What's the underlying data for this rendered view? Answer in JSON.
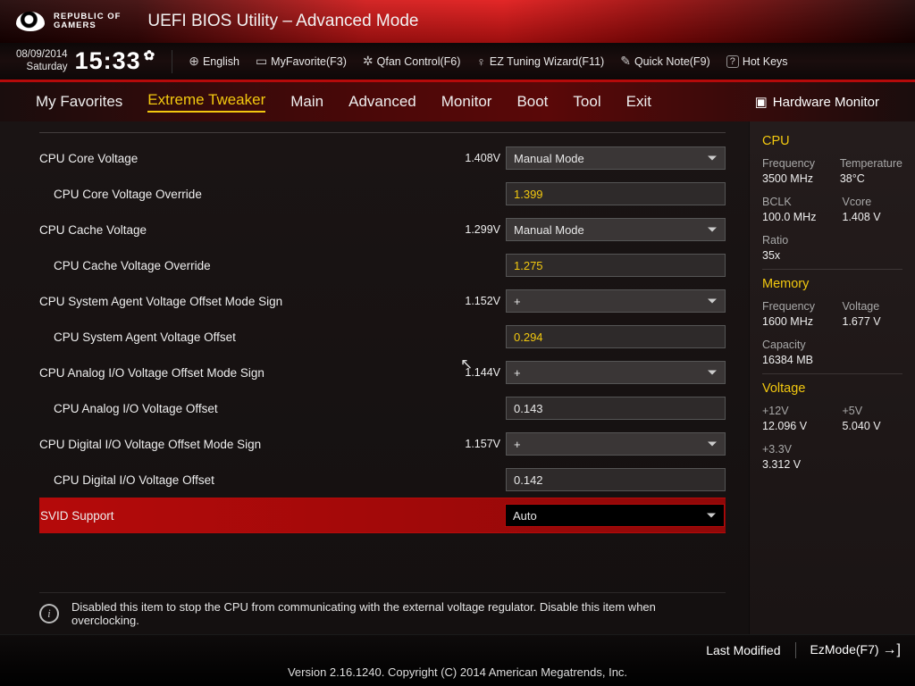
{
  "header": {
    "brand_top": "REPUBLIC OF",
    "brand_bottom": "GAMERS",
    "title": "UEFI BIOS Utility – Advanced Mode"
  },
  "toolbar": {
    "date": "08/09/2014",
    "day": "Saturday",
    "time": "15:33",
    "language": "English",
    "favorite": "MyFavorite(F3)",
    "qfan": "Qfan Control(F6)",
    "eztune": "EZ Tuning Wizard(F11)",
    "quicknote": "Quick Note(F9)",
    "hotkeys": "Hot Keys"
  },
  "tabs": {
    "items": [
      "My Favorites",
      "Extreme Tweaker",
      "Main",
      "Advanced",
      "Monitor",
      "Boot",
      "Tool",
      "Exit"
    ],
    "active": 1,
    "hwmon": "Hardware Monitor"
  },
  "rows": [
    {
      "label": "CPU Core Voltage",
      "current": "1.408V",
      "type": "select",
      "value": "Manual Mode",
      "yellow": false,
      "indent": false
    },
    {
      "label": "CPU Core Voltage Override",
      "current": "",
      "type": "input",
      "value": "1.399",
      "yellow": true,
      "indent": true
    },
    {
      "label": "CPU Cache Voltage",
      "current": "1.299V",
      "type": "select",
      "value": "Manual Mode",
      "yellow": false,
      "indent": false
    },
    {
      "label": "CPU Cache Voltage Override",
      "current": "",
      "type": "input",
      "value": "1.275",
      "yellow": true,
      "indent": true
    },
    {
      "label": "CPU System Agent Voltage Offset Mode Sign",
      "current": "1.152V",
      "type": "select",
      "value": "+",
      "yellow": false,
      "indent": false
    },
    {
      "label": "CPU System Agent Voltage Offset",
      "current": "",
      "type": "input",
      "value": "0.294",
      "yellow": true,
      "indent": true
    },
    {
      "label": "CPU Analog I/O Voltage Offset Mode Sign",
      "current": "1.144V",
      "type": "select",
      "value": "+",
      "yellow": false,
      "indent": false
    },
    {
      "label": "CPU Analog I/O Voltage Offset",
      "current": "",
      "type": "input",
      "value": "0.143",
      "yellow": false,
      "indent": true
    },
    {
      "label": "CPU Digital I/O Voltage Offset Mode Sign",
      "current": "1.157V",
      "type": "select",
      "value": "+",
      "yellow": false,
      "indent": false
    },
    {
      "label": "CPU Digital I/O Voltage Offset",
      "current": "",
      "type": "input",
      "value": "0.142",
      "yellow": false,
      "indent": true
    },
    {
      "label": "SVID Support",
      "current": "",
      "type": "select",
      "value": "Auto",
      "yellow": false,
      "indent": false,
      "selected": true
    }
  ],
  "help": {
    "text": "Disabled this item to stop the CPU from communicating with the external voltage regulator. Disable this item when overclocking."
  },
  "sidebar": {
    "cpu": {
      "title": "CPU",
      "freq_l": "Frequency",
      "freq_v": "3500 MHz",
      "temp_l": "Temperature",
      "temp_v": "38°C",
      "bclk_l": "BCLK",
      "bclk_v": "100.0 MHz",
      "vcore_l": "Vcore",
      "vcore_v": "1.408 V",
      "ratio_l": "Ratio",
      "ratio_v": "35x"
    },
    "mem": {
      "title": "Memory",
      "freq_l": "Frequency",
      "freq_v": "1600 MHz",
      "volt_l": "Voltage",
      "volt_v": "1.677 V",
      "cap_l": "Capacity",
      "cap_v": "16384 MB"
    },
    "volt": {
      "title": "Voltage",
      "v12_l": "+12V",
      "v12_v": "12.096 V",
      "v5_l": "+5V",
      "v5_v": "5.040 V",
      "v33_l": "+3.3V",
      "v33_v": "3.312 V"
    }
  },
  "footer": {
    "last": "Last Modified",
    "ezmode": "EzMode(F7)",
    "version": "Version 2.16.1240. Copyright (C) 2014 American Megatrends, Inc."
  }
}
